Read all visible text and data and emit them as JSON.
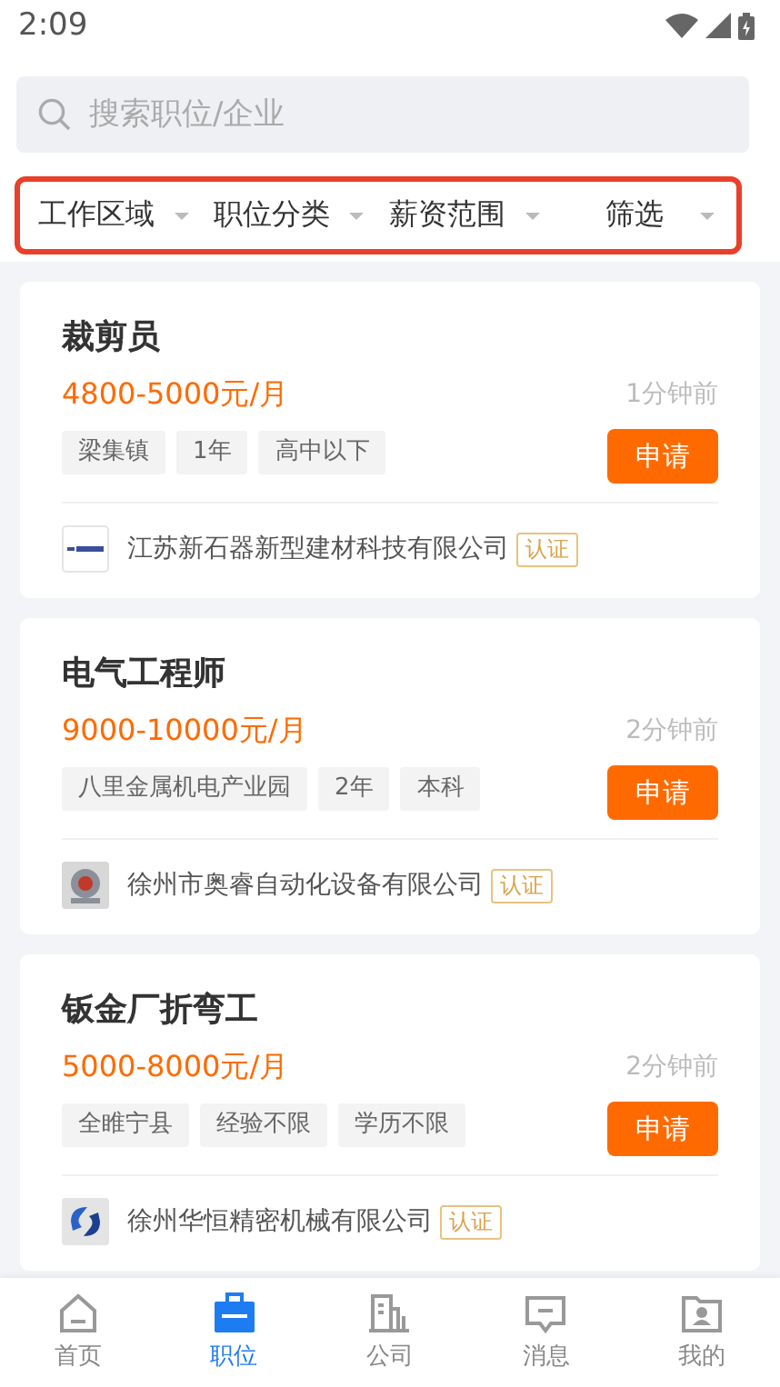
{
  "status_bar": {
    "time": "2:09"
  },
  "search": {
    "placeholder": "搜索职位/企业"
  },
  "filters": [
    {
      "label": "工作区域"
    },
    {
      "label": "职位分类"
    },
    {
      "label": "薪资范围"
    },
    {
      "label": "筛选"
    }
  ],
  "jobs": [
    {
      "title": "裁剪员",
      "salary": "4800-5000元/月",
      "posted": "1分钟前",
      "tags": [
        "梁集镇",
        "1年",
        "高中以下"
      ],
      "apply": "申请",
      "company": "江苏新石器新型建材科技有限公司",
      "badge": "认证"
    },
    {
      "title": "电气工程师",
      "salary": "9000-10000元/月",
      "posted": "2分钟前",
      "tags": [
        "八里金属机电产业园",
        "2年",
        "本科"
      ],
      "apply": "申请",
      "company": "徐州市奥睿自动化设备有限公司",
      "badge": "认证"
    },
    {
      "title": "钣金厂折弯工",
      "salary": "5000-8000元/月",
      "posted": "2分钟前",
      "tags": [
        "全睢宁县",
        "经验不限",
        "学历不限"
      ],
      "apply": "申请",
      "company": "徐州华恒精密机械有限公司",
      "badge": "认证"
    }
  ],
  "nav": [
    {
      "kind": "home",
      "label": "首页",
      "selected": false
    },
    {
      "kind": "jobs",
      "label": "职位",
      "selected": true
    },
    {
      "kind": "company",
      "label": "公司",
      "selected": false
    },
    {
      "kind": "messages",
      "label": "消息",
      "selected": false
    },
    {
      "kind": "profile",
      "label": "我的",
      "selected": false
    }
  ]
}
